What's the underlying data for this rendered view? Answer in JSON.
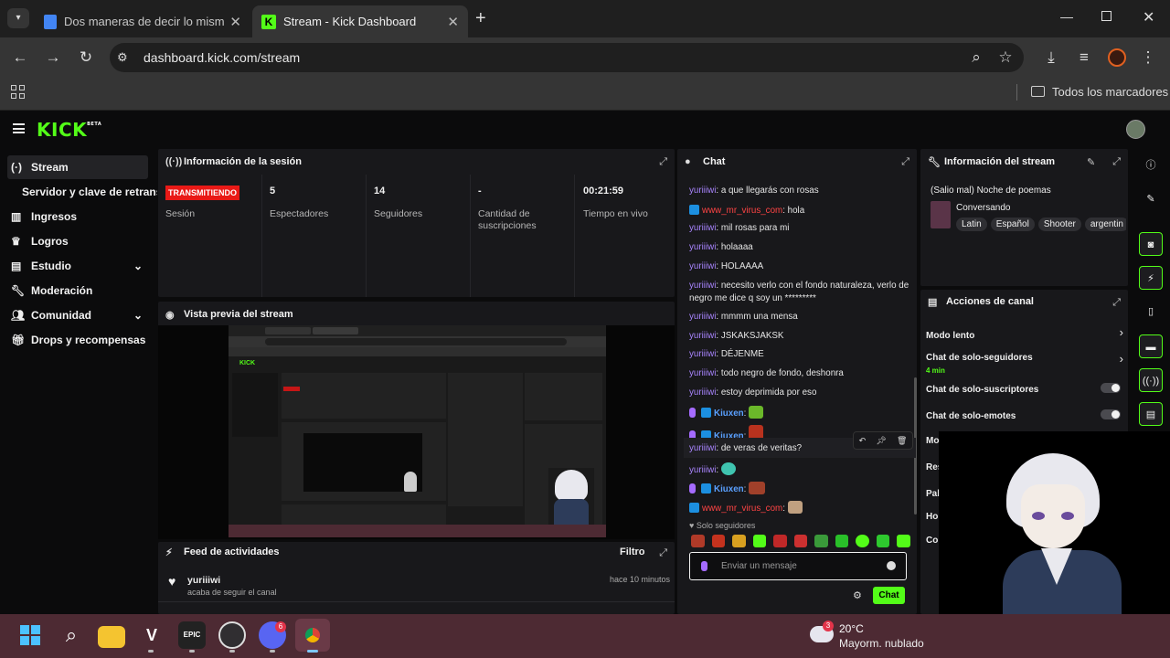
{
  "browser": {
    "tabs": [
      {
        "title": "Dos maneras de decir lo mismo"
      },
      {
        "title": "Stream - Kick Dashboard"
      }
    ],
    "url": "dashboard.kick.com/stream",
    "bookmarks_label": "Todos los marcadores"
  },
  "app": {
    "logo": "KICK",
    "logo_sup": "BETA"
  },
  "sidebar": {
    "items": [
      {
        "label": "Stream"
      },
      {
        "label": "Servidor y clave de retransmisión"
      },
      {
        "label": "Ingresos"
      },
      {
        "label": "Logros"
      },
      {
        "label": "Estudio"
      },
      {
        "label": "Moderación"
      },
      {
        "label": "Comunidad"
      },
      {
        "label": "Drops y recompensas"
      }
    ]
  },
  "session": {
    "title": "Información de la sesión",
    "status": "TRANSMITIENDO",
    "status_label": "Sesión",
    "viewers": "5",
    "viewers_label": "Espectadores",
    "followers": "14",
    "followers_label": "Seguidores",
    "subs": "-",
    "subs_label": "Cantidad de suscripciones",
    "live_time": "00:21:59",
    "live_time_label": "Tiempo en vivo"
  },
  "preview": {
    "title": "Vista previa del stream"
  },
  "feed": {
    "title": "Feed de actividades",
    "filter": "Filtro",
    "items": [
      {
        "user": "yuriiiwi",
        "action": "acaba de seguir el canal",
        "time": "hace 10 minutos"
      }
    ]
  },
  "chat": {
    "title": "Chat",
    "messages": [
      {
        "user": "yuriiiwi",
        "text": ": a que llegarás con rosas"
      },
      {
        "user": "www_mr_virus_com",
        "text": ": hola"
      },
      {
        "user": "yuriiiwi",
        "text": ": mil rosas para mi"
      },
      {
        "user": "yuriiiwi",
        "text": ": holaaaa"
      },
      {
        "user": "yuriiiwi",
        "text": ": HOLAAAA"
      },
      {
        "user": "yuriiiwi",
        "text": ": necesito verlo con el fondo naturaleza, verlo de",
        "text2": "negro me dice q soy un *********"
      },
      {
        "user": "yuriiiwi",
        "text": ": mmmm una mensa"
      },
      {
        "user": "yuriiiwi",
        "text": ": JSKAKSJAKSK"
      },
      {
        "user": "yuriiiwi",
        "text": ": DÉJENME"
      },
      {
        "user": "yuriiiwi",
        "text": ": todo negro de fondo, deshonra"
      },
      {
        "user": "yuriiiwi",
        "text": ": estoy deprimida por eso"
      },
      {
        "user": "Kiuxen",
        "text": ":"
      },
      {
        "user": "Kiuxen",
        "text": ":"
      },
      {
        "user": "yuriiiwi",
        "text": ": de veras de veritas?"
      },
      {
        "user": "yuriiiwi",
        "text": ":"
      },
      {
        "user": "Kiuxen",
        "text": ":"
      },
      {
        "user": "www_mr_virus_com",
        "text": ":"
      }
    ],
    "followers_only": "Solo seguidores",
    "input_placeholder": "Enviar un mensaje",
    "send_label": "Chat"
  },
  "stream_info": {
    "title": "Información del stream",
    "stream_title": "(Salio mal) Noche de poemas",
    "category": "Conversando",
    "tags": [
      "Latin",
      "Español",
      "Shooter",
      "argentin"
    ]
  },
  "channel_actions": {
    "title": "Acciones de canal",
    "slow_mode": "Modo lento",
    "followers_chat": "Chat de solo-seguidores",
    "followers_chat_sub": "4 min",
    "subs_chat": "Chat de solo-suscriptores",
    "emotes_chat": "Chat de solo-emotes",
    "truncated": [
      "Mo",
      "Res",
      "Pal",
      "Ho",
      "Co"
    ]
  },
  "taskbar": {
    "weather_temp": "20°C",
    "weather_desc": "Mayorm. nublado",
    "discord_badge": "6",
    "weather_badge": "3"
  },
  "colors": {
    "kick_green": "#53fc18",
    "live_red": "#e91916",
    "username": "#a985ff"
  }
}
